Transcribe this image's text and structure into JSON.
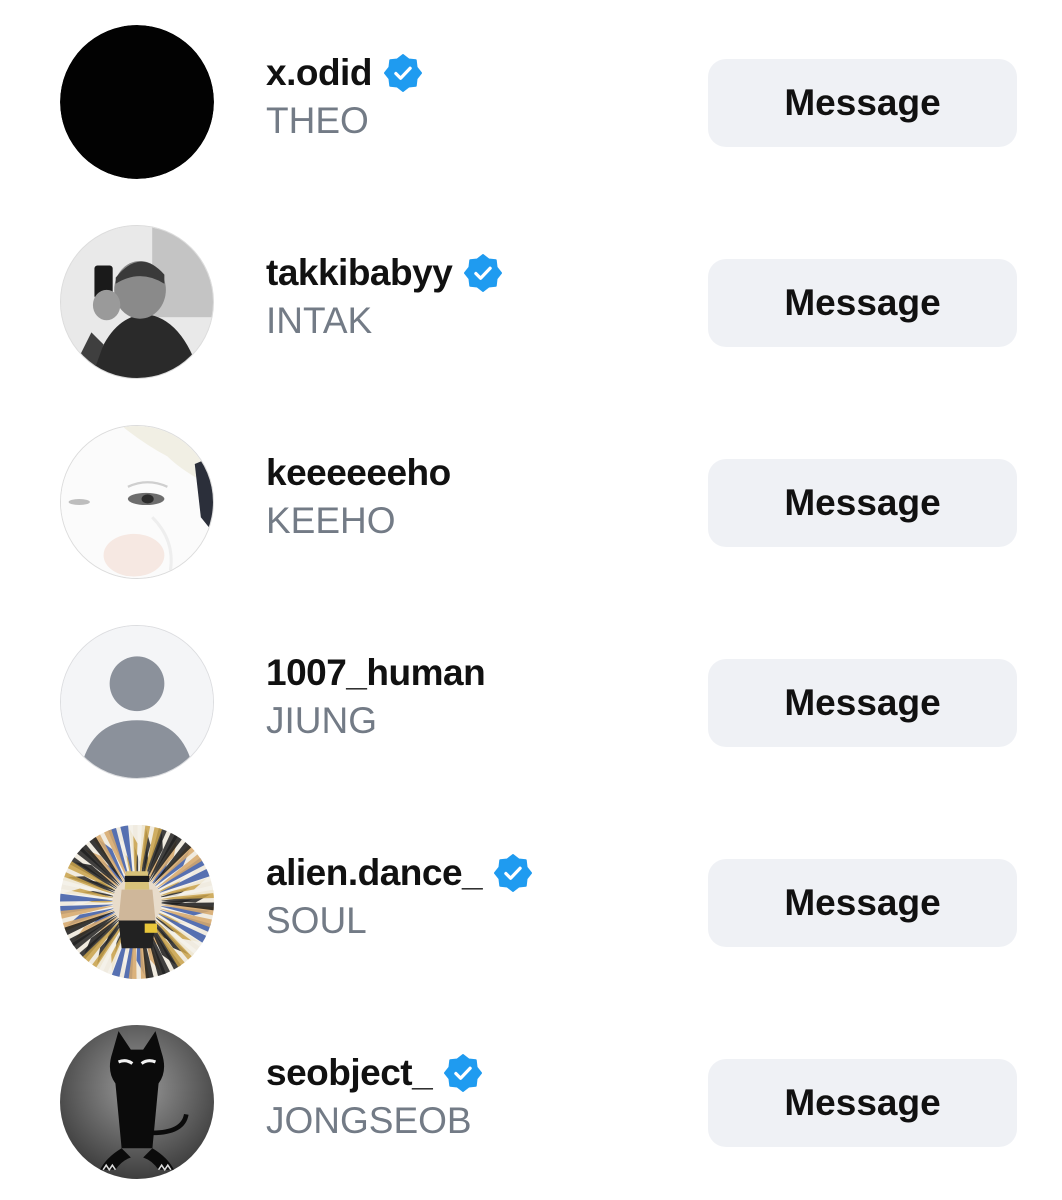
{
  "colors": {
    "verified": "#1f9bf0",
    "button_bg": "#eff1f5",
    "secondary_text": "#737b86"
  },
  "users": [
    {
      "username": "x.odid",
      "full_name": "THEO",
      "verified": true,
      "avatar": "black-circle-avatar",
      "button_label": "Message"
    },
    {
      "username": "takkibabyy",
      "full_name": "INTAK",
      "verified": true,
      "avatar": "mirror-selfie-avatar",
      "button_label": "Message"
    },
    {
      "username": "keeeeeeho",
      "full_name": "KEEHO",
      "verified": false,
      "avatar": "closeup-face-avatar",
      "button_label": "Message"
    },
    {
      "username": "1007_human",
      "full_name": "JIUNG",
      "verified": false,
      "avatar": "default-person-avatar",
      "button_label": "Message"
    },
    {
      "username": "alien.dance_",
      "full_name": "SOUL",
      "verified": true,
      "avatar": "psychedelic-avatar",
      "button_label": "Message"
    },
    {
      "username": "seobject_",
      "full_name": "JONGSEOB",
      "verified": true,
      "avatar": "black-cat-avatar",
      "button_label": "Message"
    }
  ]
}
